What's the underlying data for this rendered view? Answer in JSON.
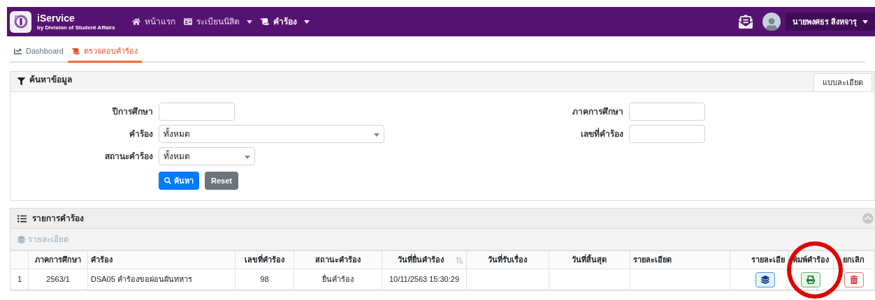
{
  "navbar": {
    "brand": "iService",
    "brand_sub": "by Division of Student Affairs",
    "menu": [
      {
        "label": "หน้าแรก",
        "dropdown": false,
        "selected": false
      },
      {
        "label": "ระเบียนนิสิต",
        "dropdown": true,
        "selected": false
      },
      {
        "label": "คำร้อง",
        "dropdown": true,
        "selected": true
      }
    ],
    "user": "นายพงศธร สิงหจารุ"
  },
  "tabs": [
    {
      "label": "Dashboard",
      "selected": false
    },
    {
      "label": "ตรวจสอบคำร้อง",
      "selected": true
    }
  ],
  "search_panel": {
    "title": "ค้นหาข้อมูล",
    "side_tab": "แบบละเอียด",
    "left_fields": [
      {
        "label": "ปีการศึกษา",
        "kind": "text"
      },
      {
        "label": "คำร้อง",
        "kind": "select",
        "value": "ทั้งหมด",
        "wide": true
      },
      {
        "label": "สถานะคำร้อง",
        "kind": "select",
        "value": "ทั้งหมด",
        "wide": false
      }
    ],
    "right_fields": [
      {
        "label": "ภาคการศึกษา",
        "kind": "text"
      },
      {
        "label": "เลขที่คำร้อง",
        "kind": "text"
      }
    ],
    "search_button": "ค้นหา",
    "reset_button": "Reset"
  },
  "list_panel": {
    "title": "รายการคำร้อง",
    "sub_title": "รายละเอียด",
    "columns": [
      {},
      {
        "label": "ภาคการศึกษา"
      },
      {
        "label": "คำร้อง"
      },
      {
        "label": "เลขที่คำร้อง"
      },
      {
        "label": "สถานะคำร้อง"
      },
      {
        "label": "วันที่ยื่นคำร้อง",
        "sortable": true
      },
      {
        "label": "วันที่รับเรื่อง"
      },
      {
        "label": "วันที่สิ้นสุด"
      },
      {
        "label": "รายละเอียด"
      },
      {
        "label": "รายละเอีย"
      },
      {
        "label": "พิมพ์คำร้อง"
      },
      {
        "label": "ยกเลิก"
      }
    ],
    "rows": [
      {
        "cells": [
          "1",
          "2563/1",
          "DSA05 คำร้องขอผ่อนผันทหาร",
          "98",
          "ยื่นคำร้อง",
          "10/11/2563 15:30:29"
        ],
        "actions": [
          {
            "kind": "detail"
          },
          {
            "kind": "print"
          },
          {
            "kind": "cancel"
          }
        ]
      }
    ]
  },
  "annotation": {
    "kind": "circle"
  }
}
